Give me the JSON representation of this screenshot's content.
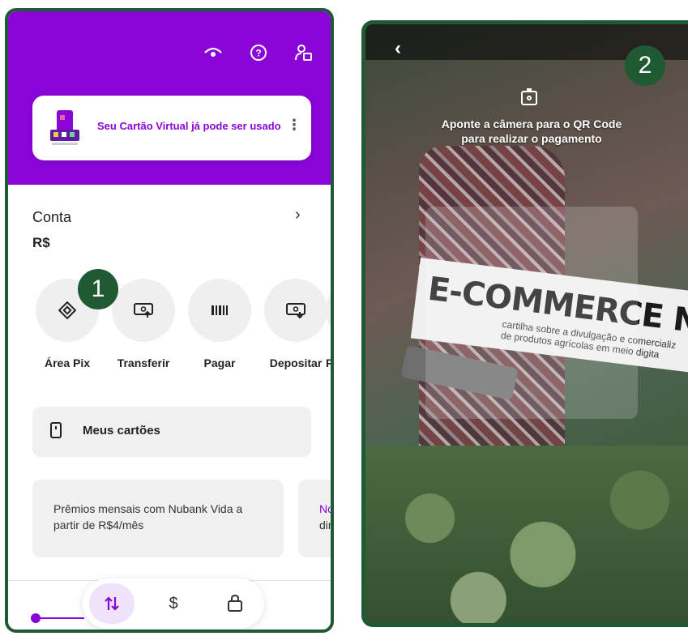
{
  "panel1": {
    "badge_number": "1",
    "banner": {
      "text": "Seu Cartão Virtual já pode ser usado",
      "more": "⋮"
    },
    "account": {
      "label": "Conta",
      "currency": "R$",
      "chevron": "›"
    },
    "actions": [
      {
        "label": "Área Pix",
        "icon": "pix-icon",
        "glyph": "◈"
      },
      {
        "label": "Transferir",
        "icon": "transfer-icon",
        "glyph": "⇪"
      },
      {
        "label": "Pagar",
        "icon": "barcode-icon",
        "glyph": "▮▮▮"
      },
      {
        "label": "Depositar",
        "icon": "deposit-icon",
        "glyph": "⇩"
      },
      {
        "label": "R",
        "icon": "more-action-icon",
        "glyph": ""
      }
    ],
    "cards_button": {
      "label": "Meus cartões"
    },
    "promo": {
      "text": "Prêmios mensais com Nubank Vida a partir de R$4/mês"
    },
    "promo2": {
      "line1": "No",
      "line2": "dir"
    },
    "tabbar": [
      {
        "icon": "transfer-arrows-icon",
        "glyph": "⇅"
      },
      {
        "icon": "dollar-icon",
        "glyph": "$"
      },
      {
        "icon": "shopping-bag-icon",
        "glyph": "⌂"
      }
    ],
    "header_icons": [
      {
        "icon": "eye-icon",
        "glyph": "◉"
      },
      {
        "icon": "help-icon",
        "glyph": "?"
      },
      {
        "icon": "profile-icon",
        "glyph": "♙"
      }
    ],
    "colors": {
      "accent": "#8a05d8",
      "badge": "#1f5a34"
    }
  },
  "panel2": {
    "badge_number": "2",
    "back": "‹",
    "instruction_line1": "Aponte a câmera para o QR Code",
    "instruction_line2": "para realizar o pagamento",
    "book_title": "E-COMMERCE NA ZON",
    "book_sub1": "cartilha sobre a divulgação e comercializ",
    "book_sub2": "de produtos agrícolas em meio digita"
  }
}
